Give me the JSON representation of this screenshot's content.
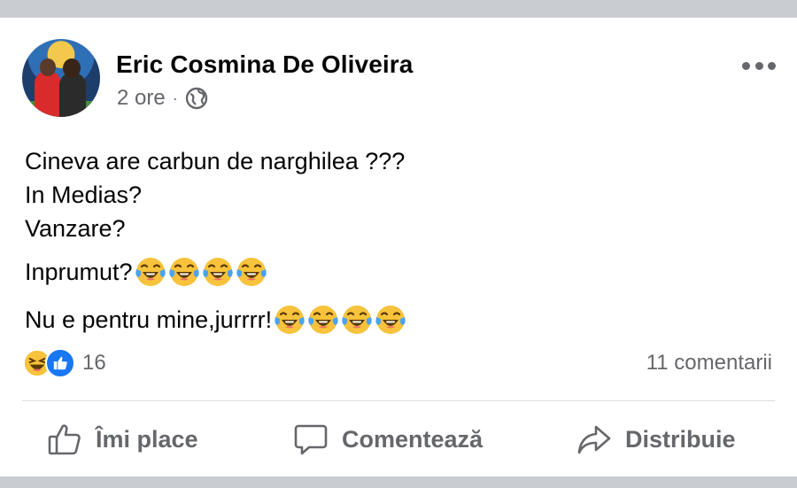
{
  "post": {
    "author": "Eric Cosmina De Oliveira",
    "time": "2 ore",
    "separator": "·",
    "privacy_icon": "globe-icon",
    "lines": [
      "Cineva are carbun de narghilea ???",
      "In Medias?",
      "Vanzare?",
      "Inprumut?",
      "Nu e pentru mine,jurrrr!"
    ],
    "line4_emoji_count": 4,
    "line5_emoji_count": 4,
    "emoji_name": "face-with-tears-of-joy"
  },
  "reactions": {
    "count": "16",
    "types": [
      "haha",
      "like"
    ]
  },
  "comments_label": "11 comentarii",
  "actions": {
    "like": "Îmi place",
    "comment": "Comentează",
    "share": "Distribuie"
  },
  "colors": {
    "background": "#c9ccd1",
    "card": "#ffffff",
    "secondary_text": "#65676b",
    "like_blue": "#1877f2",
    "emoji_yellow": "#f7c23c"
  }
}
